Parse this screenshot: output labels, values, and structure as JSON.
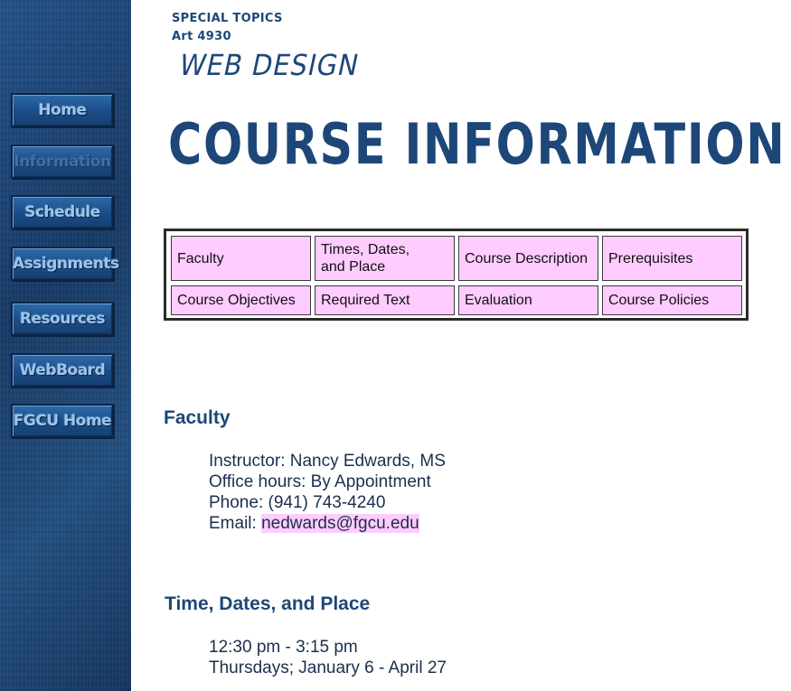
{
  "nav": {
    "items": [
      {
        "label": "Home",
        "current": false
      },
      {
        "label": "Information",
        "current": true
      },
      {
        "label": "Schedule",
        "current": false
      },
      {
        "label": "Assignments",
        "current": false
      },
      {
        "label": "Resources",
        "current": false
      },
      {
        "label": "WebBoard",
        "current": false
      },
      {
        "label": "FGCU Home",
        "current": false
      }
    ]
  },
  "header": {
    "line1": "SPECIAL TOPICS",
    "line2": "Art 4930",
    "subtitle": "WEB DESIGN",
    "title": "COURSE INFORMATION"
  },
  "table": {
    "row1": [
      "Faculty",
      "Times, Dates, and Place",
      "Course Description",
      "Prerequisites"
    ],
    "row2": [
      "Course Objectives",
      "Required Text",
      "Evaluation",
      "Course Policies"
    ]
  },
  "faculty": {
    "heading": "Faculty",
    "instructor": "Instructor: Nancy Edwards, MS",
    "office_hours": "Office hours: By Appointment",
    "phone": "Phone: (941) 743-4240",
    "email_label": "Email: ",
    "email": "nedwards@fgcu.edu"
  },
  "time": {
    "heading": "Time, Dates, and Place",
    "hours": "12:30 pm - 3:15 pm",
    "days": "Thursdays; January 6 - April 27"
  },
  "colors": {
    "navy": "#1d4778",
    "cell_pink": "#ffccff",
    "sidebar_blue": "#1d4778"
  }
}
